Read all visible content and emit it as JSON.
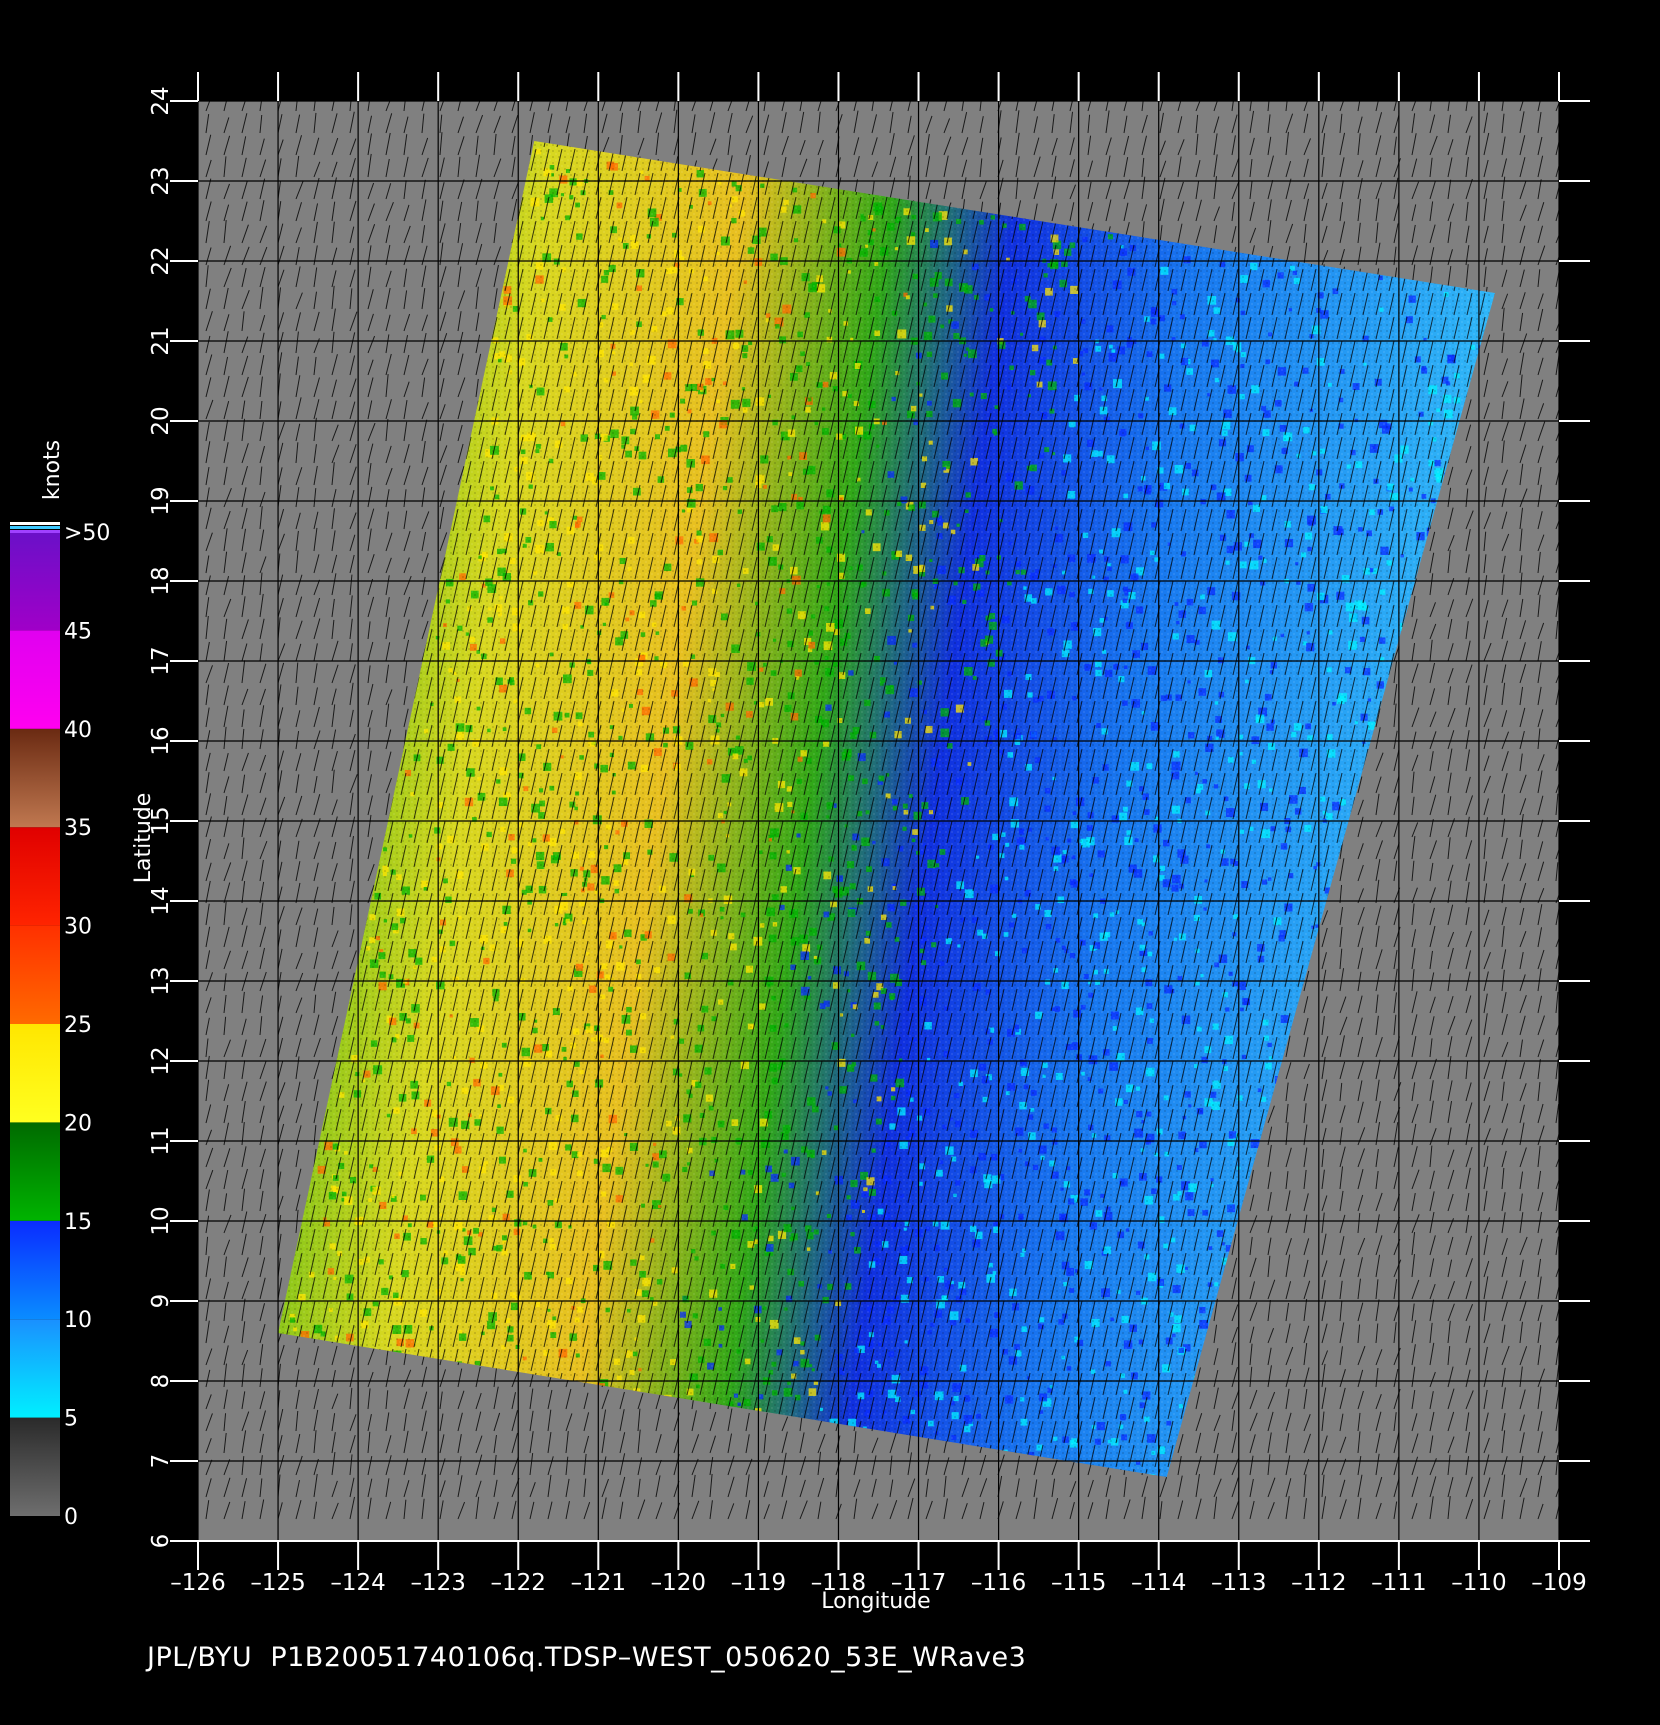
{
  "footer": {
    "caption": "JPL/BYU  P1B20051740106q.TDSP–WEST_050620_53E_WRave3"
  },
  "axes": {
    "xlabel": "Longitude",
    "ylabel": "Latitude",
    "x_ticks": [
      -126,
      -125,
      -124,
      -123,
      -122,
      -121,
      -120,
      -119,
      -118,
      -117,
      -116,
      -115,
      -114,
      -113,
      -112,
      -111,
      -110,
      -109
    ],
    "y_ticks": [
      6,
      7,
      8,
      9,
      10,
      11,
      12,
      13,
      14,
      15,
      16,
      17,
      18,
      19,
      20,
      21,
      22,
      23,
      24
    ],
    "xlim": [
      -126,
      -109
    ],
    "ylim": [
      6,
      24
    ]
  },
  "colorbar": {
    "unit": "knots",
    "labels": [
      "0",
      "5",
      "10",
      "15",
      "20",
      "25",
      "30",
      "35",
      "40",
      "45",
      ">50"
    ],
    "colors": {
      "grey": "#6e6e6e",
      "cyan": "#00f0ff",
      "blue": "#0a2cff",
      "green": "#00b400",
      "yellow": "#ffe600",
      "orange": "#ff6a00",
      "red": "#ff2400",
      "brown": "#6a2a12",
      "magenta": "#ff00f0",
      "purple": "#6a10c8"
    }
  },
  "map": {
    "background": "#808080",
    "swath_corners_lonlat": [
      [
        -121.8,
        23.5
      ],
      [
        -109.8,
        21.6
      ],
      [
        -113.9,
        6.8
      ],
      [
        -125.0,
        8.6
      ]
    ],
    "swath_palette": [
      "#00f0ff",
      "#0a2cff",
      "#00b400",
      "#ffe600",
      "#ff6a00"
    ],
    "grid_color": "#000000"
  }
}
